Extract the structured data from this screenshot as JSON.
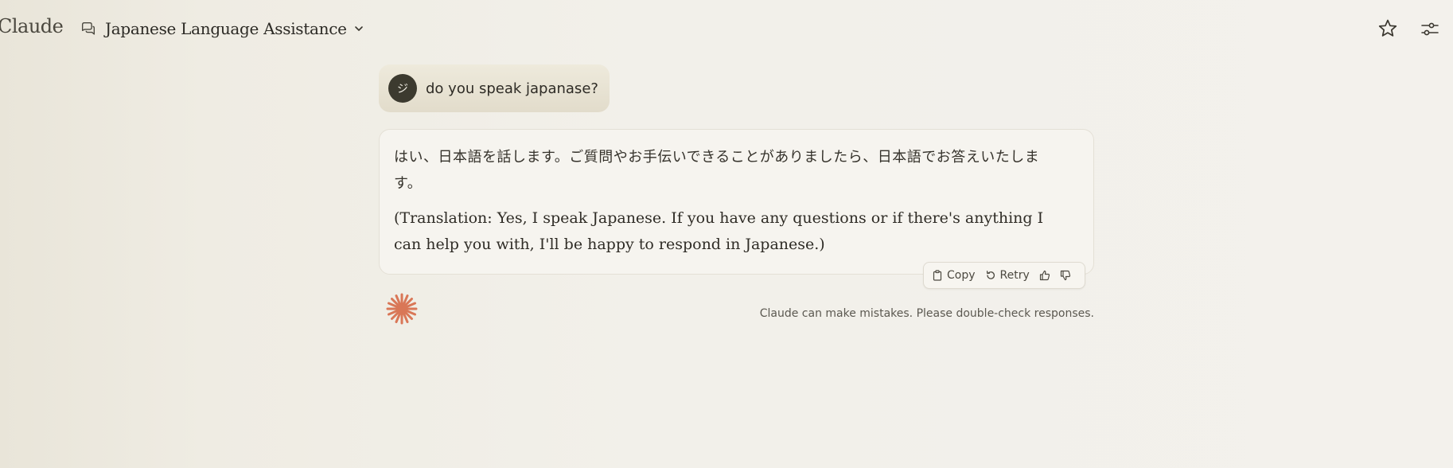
{
  "header": {
    "brand": "Claude",
    "chat_title": "Japanese Language Assistance",
    "icons": {
      "chat": "chat-bubbles-icon",
      "dropdown": "chevron-down-icon",
      "star": "star-icon",
      "settings": "sliders-icon"
    }
  },
  "conversation": {
    "user_message": {
      "avatar_initial": "ジ",
      "text": "do you speak japanase?"
    },
    "assistant_message": {
      "text_japanese": "はい、日本語を話します。ご質問やお手伝いできることがありましたら、日本語でお答えいたします。",
      "text_translation": "(Translation: Yes, I speak Japanese. If you have any questions or if there's anything I can help you with, I'll be happy to respond in Japanese.)"
    },
    "actions": {
      "copy_label": "Copy",
      "retry_label": "Retry",
      "icons": [
        "clipboard-icon",
        "retry-icon",
        "thumbs-up-icon",
        "thumbs-down-icon"
      ]
    }
  },
  "footer": {
    "disclaimer": "Claude can make mistakes. Please double-check responses."
  },
  "colors": {
    "background": "#f2f0ea",
    "accent_logo": "#d97757",
    "avatar_bg": "#3c3a2f",
    "user_bubble": "#e6e1d2"
  }
}
